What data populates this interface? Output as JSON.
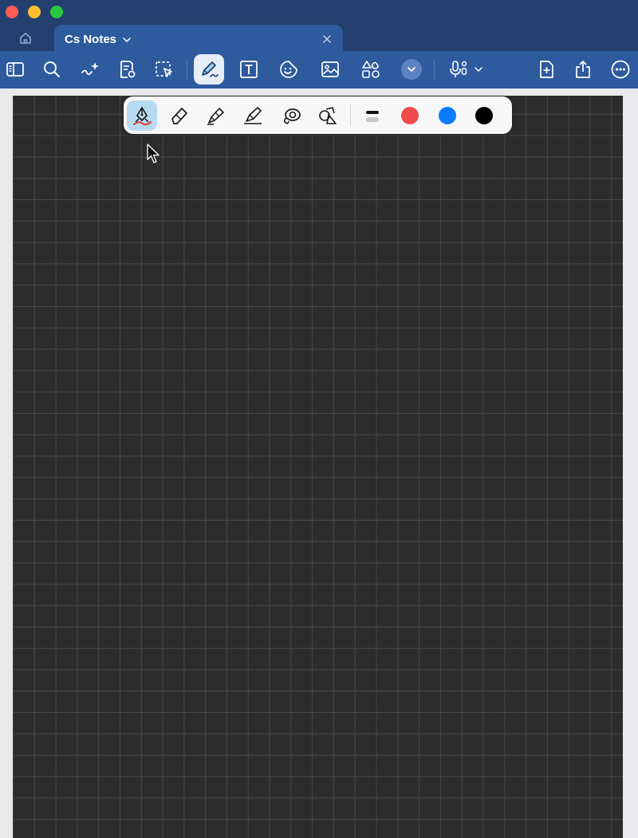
{
  "window": {
    "tab_title": "Cs Notes"
  },
  "toolbar": {
    "items": [
      {
        "name": "sidebar-icon"
      },
      {
        "name": "search-icon"
      },
      {
        "name": "ai-assistant-icon"
      },
      {
        "name": "page-settings-icon"
      },
      {
        "name": "lasso-select-icon"
      },
      {
        "name": "pen-tool-icon",
        "active": true
      },
      {
        "name": "text-box-icon"
      },
      {
        "name": "sticker-icon"
      },
      {
        "name": "image-icon"
      },
      {
        "name": "shapes-icon"
      },
      {
        "name": "more-tools-chevron-icon"
      },
      {
        "name": "audio-record-icon"
      },
      {
        "name": "add-page-icon"
      },
      {
        "name": "share-icon"
      },
      {
        "name": "more-options-icon"
      }
    ]
  },
  "pen_toolbar": {
    "tools": [
      {
        "name": "fountain-pen-icon",
        "active": true
      },
      {
        "name": "eraser-icon"
      },
      {
        "name": "highlighter-icon"
      },
      {
        "name": "marker-icon"
      },
      {
        "name": "lasso-icon"
      },
      {
        "name": "shape-recognition-icon"
      }
    ],
    "colors": {
      "red": "#ef4b4b",
      "blue": "#0a7bff",
      "black": "#000000"
    }
  },
  "theme": {
    "titlebar": "#223f6f",
    "toolbar": "#2e5a9e",
    "canvas": "#2c2c2c",
    "grid": "#464646"
  }
}
